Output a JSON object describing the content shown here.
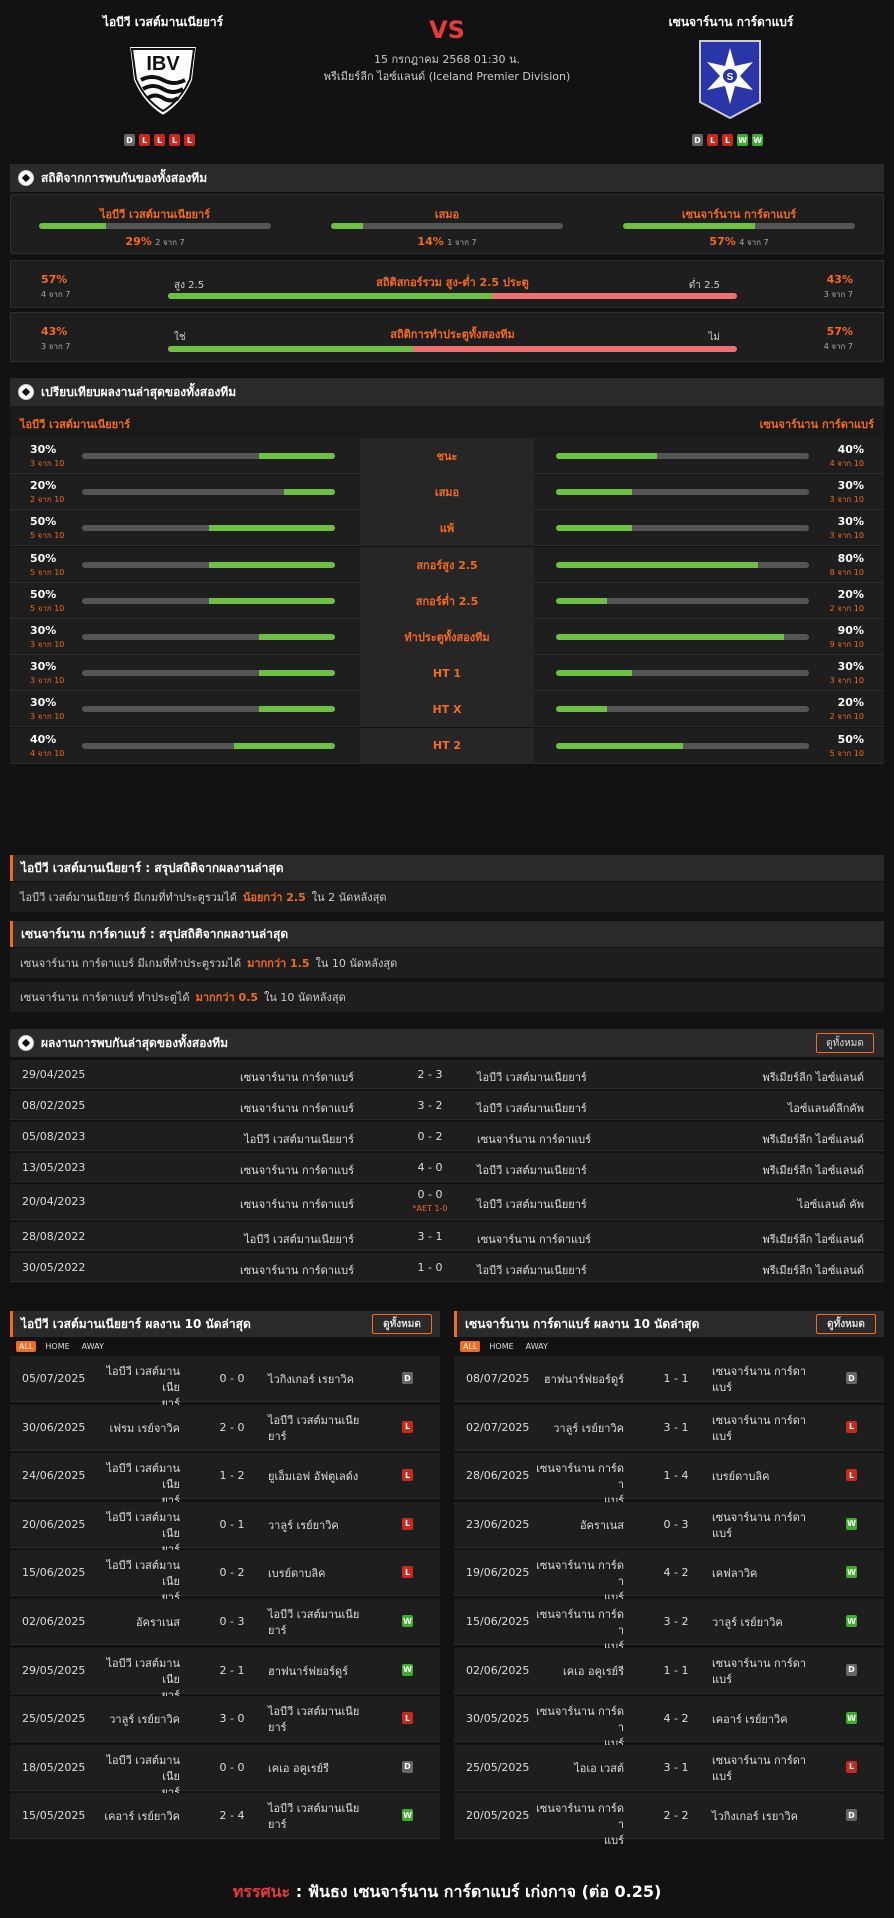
{
  "match": {
    "home": "ไอบีวี เวสต์มานเนียยาร์",
    "away": "เซนจาร์นาน การ์ดาแบร์",
    "vs": "VS",
    "datetime": "15 กรกฎาคม 2568 01:30 น.",
    "league": "พรีเมียร์ลีก ไอซ์แลนด์ (Iceland Premier Division)",
    "home_form": [
      "D",
      "L",
      "L",
      "L",
      "L"
    ],
    "away_form": [
      "D",
      "L",
      "L",
      "W",
      "W"
    ]
  },
  "h2h_stats": {
    "title": "สถิติจากการพบกันของทั้งสองทีม",
    "home": {
      "label": "ไอบีวี เวสต์มานเนียยาร์",
      "pct": "29%",
      "sub": "2 จาก 7",
      "ratio": 0.29
    },
    "draw": {
      "label": "เสมอ",
      "pct": "14%",
      "sub": "1 จาก 7",
      "ratio": 0.14
    },
    "away": {
      "label": "เซนจาร์นาน การ์ดาแบร์",
      "pct": "57%",
      "sub": "4 จาก 7",
      "ratio": 0.57
    },
    "ou": {
      "title": "สถิติสกอร์รวม สูง-ต่ำ 2.5 ประตู",
      "left_pct": "57%",
      "left_sub": "4 จาก 7",
      "right_pct": "43%",
      "right_sub": "3 จาก 7",
      "left_label": "สูง 2.5",
      "right_label": "ต่ำ 2.5",
      "ratio": 0.57
    },
    "btts": {
      "title": "สถิติการทำประตูทั้งสองทีม",
      "left_pct": "43%",
      "left_sub": "3 จาก 7",
      "right_pct": "57%",
      "right_sub": "4 จาก 7",
      "left_label": "ใช่",
      "right_label": "ไม่",
      "ratio": 0.43
    }
  },
  "compare": {
    "title": "เปรียบเทียบผลงานล่าสุดของทั้งสองทีม",
    "home": "ไอบีวี เวสต์มานเนียยาร์",
    "away": "เซนจาร์นาน การ์ดาแบร์",
    "rows": [
      {
        "label": "ชนะ",
        "hp": "30%",
        "hs": "3 จาก 10",
        "hr": 0.3,
        "ap": "40%",
        "as": "4 จาก 10",
        "ar": 0.4
      },
      {
        "label": "เสมอ",
        "hp": "20%",
        "hs": "2 จาก 10",
        "hr": 0.2,
        "ap": "30%",
        "as": "3 จาก 10",
        "ar": 0.3
      },
      {
        "label": "แพ้",
        "hp": "50%",
        "hs": "5 จาก 10",
        "hr": 0.5,
        "ap": "30%",
        "as": "3 จาก 10",
        "ar": 0.3
      },
      {
        "label": "สกอร์สูง 2.5",
        "hp": "50%",
        "hs": "5 จาก 10",
        "hr": 0.5,
        "ap": "80%",
        "as": "8 จาก 10",
        "ar": 0.8
      },
      {
        "label": "สกอร์ต่ำ 2.5",
        "hp": "50%",
        "hs": "5 จาก 10",
        "hr": 0.5,
        "ap": "20%",
        "as": "2 จาก 10",
        "ar": 0.2
      },
      {
        "label": "ทำประตูทั้งสองทีม",
        "hp": "30%",
        "hs": "3 จาก 10",
        "hr": 0.3,
        "ap": "90%",
        "as": "9 จาก 10",
        "ar": 0.9
      },
      {
        "label": "HT 1",
        "hp": "30%",
        "hs": "3 จาก 10",
        "hr": 0.3,
        "ap": "30%",
        "as": "3 จาก 10",
        "ar": 0.3
      },
      {
        "label": "HT X",
        "hp": "30%",
        "hs": "3 จาก 10",
        "hr": 0.3,
        "ap": "20%",
        "as": "2 จาก 10",
        "ar": 0.2
      },
      {
        "label": "HT 2",
        "hp": "40%",
        "hs": "4 จาก 10",
        "hr": 0.4,
        "ap": "50%",
        "as": "5 จาก 10",
        "ar": 0.5
      }
    ]
  },
  "summary_home": {
    "title": "ไอบีวี เวสต์มานเนียยาร์ : สรุปสถิติจากผลงานล่าสุด",
    "rows": [
      {
        "pre": "ไอบีวี เวสต์มานเนียยาร์ มีเกมที่ทำประตูรวมได้",
        "hl": "น้อยกว่า 2.5",
        "post": "ใน 2 นัดหลังสุด"
      }
    ]
  },
  "summary_away": {
    "title": "เซนจาร์นาน การ์ดาแบร์ : สรุปสถิติจากผลงานล่าสุด",
    "rows": [
      {
        "pre": "เซนจาร์นาน การ์ดาแบร์ มีเกมที่ทำประตูรวมได้",
        "hl": "มากกว่า 1.5",
        "post": "ใน 10 นัดหลังสุด"
      },
      {
        "pre": "เซนจาร์นาน การ์ดาแบร์ ทำประตูได้",
        "hl": "มากกว่า 0.5",
        "post": "ใน 10 นัดหลังสุด"
      }
    ]
  },
  "h2h": {
    "title": "ผลงานการพบกันล่าสุดของทั้งสองทีม",
    "all_label": "ดูทั้งหมด",
    "rows": [
      {
        "date": "29/04/2025",
        "home": "เซนจาร์นาน การ์ดาแบร์",
        "score": "2 - 3",
        "note": "",
        "away": "ไอบีวี เวสต์มานเนียยาร์",
        "comp": "พรีเมียร์ลีก ไอซ์แลนด์"
      },
      {
        "date": "08/02/2025",
        "home": "เซนจาร์นาน การ์ดาแบร์",
        "score": "3 - 2",
        "note": "",
        "away": "ไอบีวี เวสต์มานเนียยาร์",
        "comp": "ไอซ์แลนด์ลีกคัพ"
      },
      {
        "date": "05/08/2023",
        "home": "ไอบีวี เวสต์มานเนียยาร์",
        "score": "0 - 2",
        "note": "",
        "away": "เซนจาร์นาน การ์ดาแบร์",
        "comp": "พรีเมียร์ลีก ไอซ์แลนด์"
      },
      {
        "date": "13/05/2023",
        "home": "เซนจาร์นาน การ์ดาแบร์",
        "score": "4 - 0",
        "note": "",
        "away": "ไอบีวี เวสต์มานเนียยาร์",
        "comp": "พรีเมียร์ลีก ไอซ์แลนด์"
      },
      {
        "date": "20/04/2023",
        "home": "เซนจาร์นาน การ์ดาแบร์",
        "score": "0 - 0",
        "note": "*AET 1-0",
        "away": "ไอบีวี เวสต์มานเนียยาร์",
        "comp": "ไอซ์แลนด์ คัพ"
      },
      {
        "date": "28/08/2022",
        "home": "ไอบีวี เวสต์มานเนียยาร์",
        "score": "3 - 1",
        "note": "",
        "away": "เซนจาร์นาน การ์ดาแบร์",
        "comp": "พรีเมียร์ลีก ไอซ์แลนด์"
      },
      {
        "date": "30/05/2022",
        "home": "เซนจาร์นาน การ์ดาแบร์",
        "score": "1 - 0",
        "note": "",
        "away": "ไอบีวี เวสต์มานเนียยาร์",
        "comp": "พรีเมียร์ลีก ไอซ์แลนด์"
      }
    ]
  },
  "last_home": {
    "title": "ไอบีวี เวสต์มานเนียยาร์ ผลงาน 10 นัดล่าสุด",
    "all_label": "ดูทั้งหมด",
    "tabs": [
      "ALL",
      "HOME",
      "AWAY"
    ],
    "rows": [
      {
        "date": "05/07/2025",
        "home": "ไอบีวี เวสต์มานเนีย\nยาร์",
        "score": "0 - 0",
        "away": "ไวกิงเกอร์ เรยาวิค",
        "res": "D"
      },
      {
        "date": "30/06/2025",
        "home": "เฟรม เรย์จาวิค",
        "score": "2 - 0",
        "away": "ไอบีวี เวสต์มานเนีย\nยาร์",
        "res": "L"
      },
      {
        "date": "24/06/2025",
        "home": "ไอบีวี เวสต์มานเนีย\nยาร์",
        "score": "1 - 2",
        "away": "ยูเอ็มเอฟ อัฟตูเลด์ง",
        "res": "L"
      },
      {
        "date": "20/06/2025",
        "home": "ไอบีวี เวสต์มานเนีย\nยาร์",
        "score": "0 - 1",
        "away": "วาลูร์ เรย์ยาวิค",
        "res": "L"
      },
      {
        "date": "15/06/2025",
        "home": "ไอบีวี เวสต์มานเนีย\nยาร์",
        "score": "0 - 2",
        "away": "เบรย์ดาบลิค",
        "res": "L"
      },
      {
        "date": "02/06/2025",
        "home": "อัคราเนส",
        "score": "0 - 3",
        "away": "ไอบีวี เวสต์มานเนีย\nยาร์",
        "res": "W"
      },
      {
        "date": "29/05/2025",
        "home": "ไอบีวี เวสต์มานเนีย\nยาร์",
        "score": "2 - 1",
        "away": "ฮาฟนาร์ฟยอร์ดูร์",
        "res": "W"
      },
      {
        "date": "25/05/2025",
        "home": "วาลูร์ เรย์ยาวิค",
        "score": "3 - 0",
        "away": "ไอบีวี เวสต์มานเนีย\nยาร์",
        "res": "L"
      },
      {
        "date": "18/05/2025",
        "home": "ไอบีวี เวสต์มานเนีย\nยาร์",
        "score": "0 - 0",
        "away": "เคเอ อคูเรย์รี",
        "res": "D"
      },
      {
        "date": "15/05/2025",
        "home": "เคอาร์ เรย์ยาวิค",
        "score": "2 - 4",
        "away": "ไอบีวี เวสต์มานเนีย\nยาร์",
        "res": "W"
      }
    ]
  },
  "last_away": {
    "title": "เซนจาร์นาน การ์ดาแบร์ ผลงาน 10 นัดล่าสุด",
    "all_label": "ดูทั้งหมด",
    "tabs": [
      "ALL",
      "HOME",
      "AWAY"
    ],
    "rows": [
      {
        "date": "08/07/2025",
        "home": "ฮาฟนาร์ฟยอร์ดูร์",
        "score": "1 - 1",
        "away": "เซนจาร์นาน การ์ดา\nแบร์",
        "res": "D"
      },
      {
        "date": "02/07/2025",
        "home": "วาลูร์ เรย์ยาวิค",
        "score": "3 - 1",
        "away": "เซนจาร์นาน การ์ดา\nแบร์",
        "res": "L"
      },
      {
        "date": "28/06/2025",
        "home": "เซนจาร์นาน การ์ดา\nแบร์",
        "score": "1 - 4",
        "away": "เบรย์ดาบลิค",
        "res": "L"
      },
      {
        "date": "23/06/2025",
        "home": "อัคราเนส",
        "score": "0 - 3",
        "away": "เซนจาร์นาน การ์ดา\nแบร์",
        "res": "W"
      },
      {
        "date": "19/06/2025",
        "home": "เซนจาร์นาน การ์ดา\nแบร์",
        "score": "4 - 2",
        "away": "เคฟลาวิค",
        "res": "W"
      },
      {
        "date": "15/06/2025",
        "home": "เซนจาร์นาน การ์ดา\nแบร์",
        "score": "3 - 2",
        "away": "วาลูร์ เรย์ยาวิค",
        "res": "W"
      },
      {
        "date": "02/06/2025",
        "home": "เคเอ อคูเรย์รี",
        "score": "1 - 1",
        "away": "เซนจาร์นาน การ์ดา\nแบร์",
        "res": "D"
      },
      {
        "date": "30/05/2025",
        "home": "เซนจาร์นาน การ์ดา\nแบร์",
        "score": "4 - 2",
        "away": "เคอาร์ เรย์ยาวิค",
        "res": "W"
      },
      {
        "date": "25/05/2025",
        "home": "ไอเอ เวสต์",
        "score": "3 - 1",
        "away": "เซนจาร์นาน การ์ดา\nแบร์",
        "res": "L"
      },
      {
        "date": "20/05/2025",
        "home": "เซนจาร์นาน การ์ดา\nแบร์",
        "score": "2 - 2",
        "away": "ไวกิงเกอร์ เรยาวิค",
        "res": "D"
      }
    ]
  },
  "verdict": {
    "label": "ทรรศนะ",
    "sep": ":",
    "text": "ฟันธง เซนจาร์นาน การ์ดาแบร์ เก่งกาจ (ต่อ 0.25)"
  },
  "colors": {
    "accent": "#f46a1f",
    "win": "#3cae2a",
    "loss": "#c8281e",
    "draw": "#666666",
    "bar": "#6dc043",
    "bar_red": "#f07070"
  }
}
